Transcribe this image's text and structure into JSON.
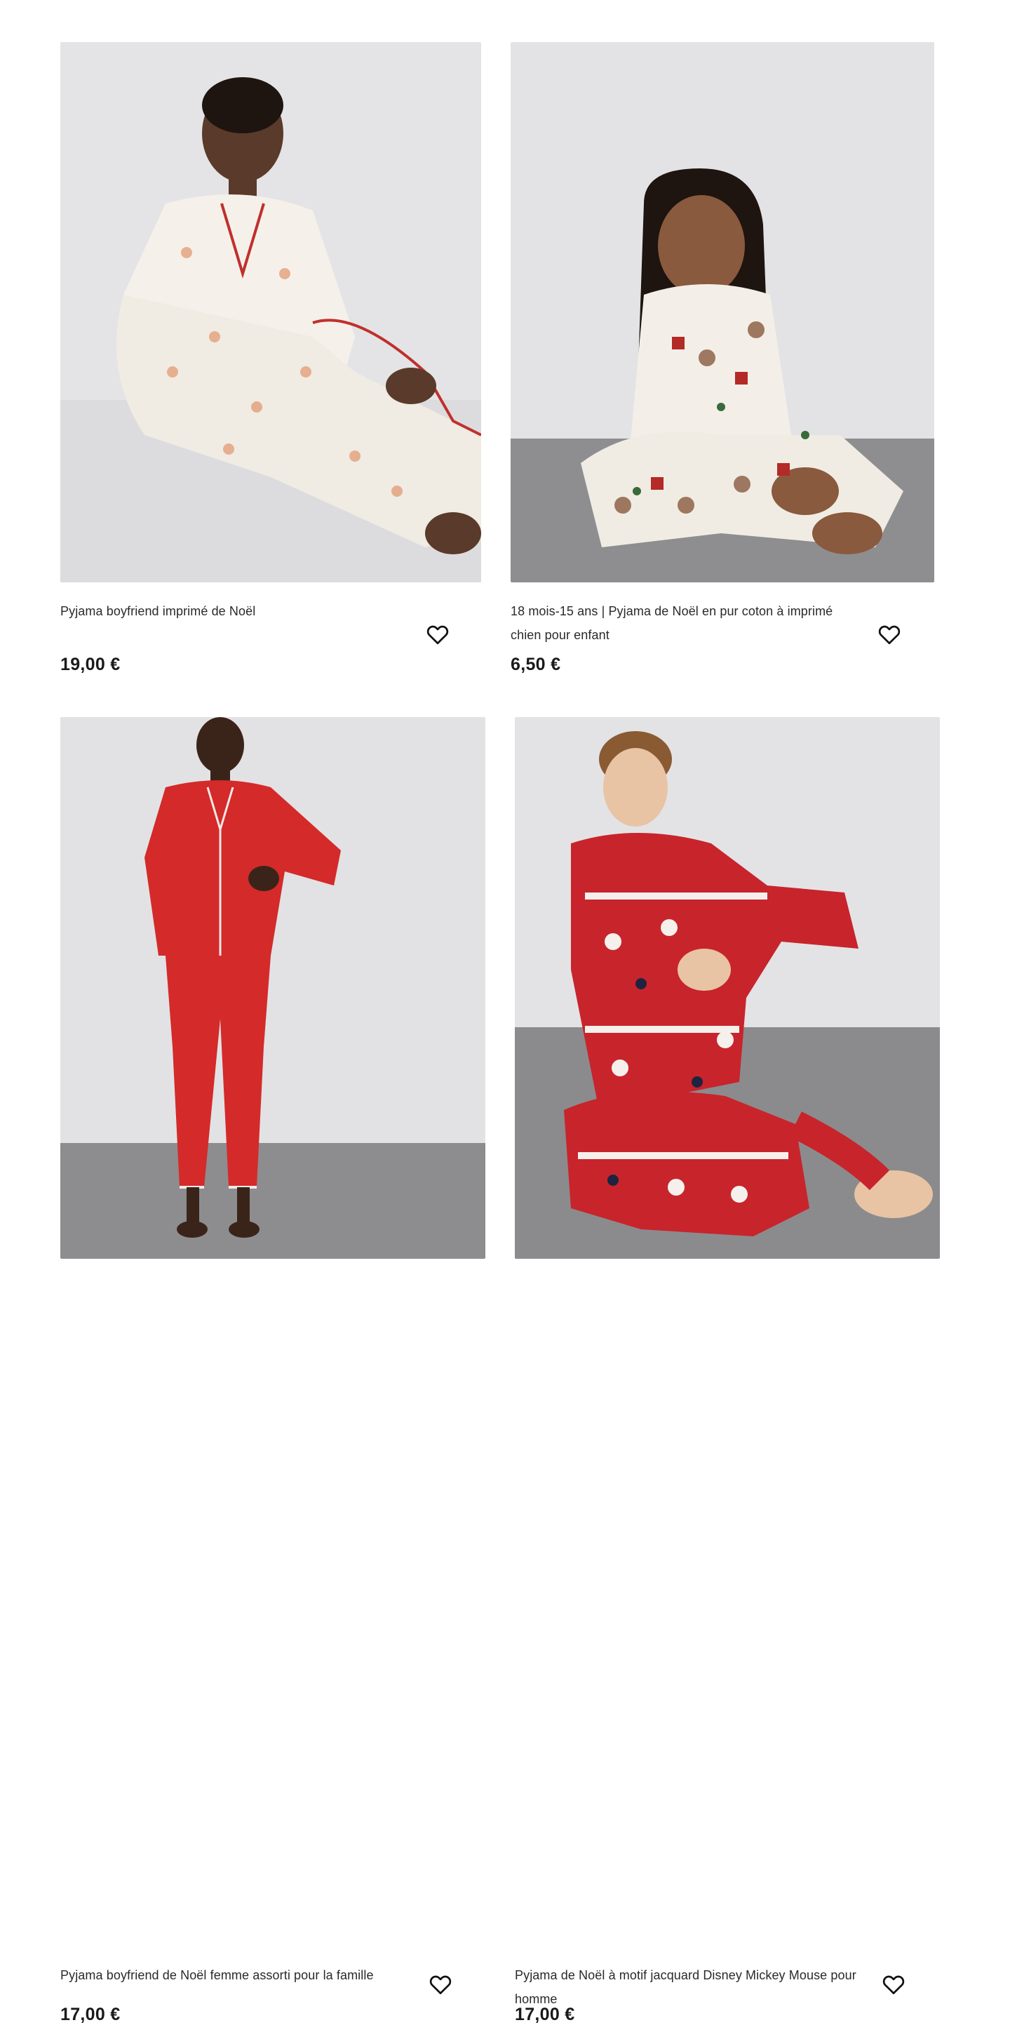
{
  "products": [
    {
      "title": "Pyjama boyfriend imprimé de Noël",
      "price": "19,00 €",
      "wishlist_icon": "heart-outline-icon",
      "image_subject": "woman-white-gingerbread-pyjama",
      "colors": {
        "wall": "#e4e4e6",
        "floor": "#dcdcde",
        "garment": "#f5f1ea",
        "trim": "#c0302c"
      }
    },
    {
      "title": "18 mois-15 ans | Pyjama de Noël en pur coton à imprimé chien pour enfant",
      "price": "6,50 €",
      "wishlist_icon": "heart-outline-icon",
      "image_subject": "child-white-dog-print-pyjama",
      "colors": {
        "wall": "#e3e3e5",
        "floor": "#8e8e90",
        "garment": "#f3efe8",
        "trim": "#b32a26"
      }
    },
    {
      "title": "Pyjama boyfriend de Noël femme assorti pour la famille",
      "price": "17,00 €",
      "wishlist_icon": "heart-outline-icon",
      "image_subject": "woman-red-pyjama-standing",
      "colors": {
        "wall": "#e2e2e4",
        "floor": "#8d8d8f",
        "garment": "#d42a2a",
        "trim": "#f4e9e6"
      }
    },
    {
      "title": "Pyjama de Noël à motif jacquard Disney Mickey Mouse pour homme",
      "price": "17,00 €",
      "wishlist_icon": "heart-outline-icon",
      "image_subject": "man-red-mickey-jacquard-pyjama",
      "colors": {
        "wall": "#e3e3e5",
        "floor": "#8b8b8d",
        "garment": "#c8242c",
        "trim": "#f6f0ec"
      }
    }
  ]
}
